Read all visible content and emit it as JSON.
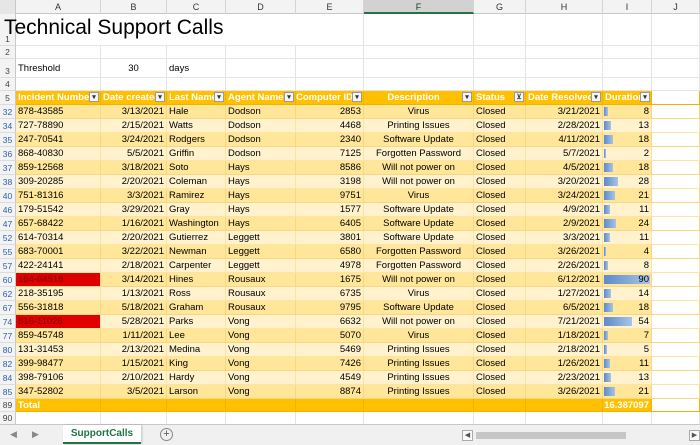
{
  "columns": [
    "A",
    "B",
    "C",
    "D",
    "E",
    "F",
    "G",
    "H",
    "I",
    "J"
  ],
  "title": "Technical Support Calls",
  "threshold": {
    "label": "Threshold",
    "value": "30",
    "unit": "days"
  },
  "headers": [
    "Incident Number",
    "Date created",
    "Last Name",
    "Agent Name",
    "Computer ID",
    "Description",
    "Status",
    "Date Resolved",
    "Duration"
  ],
  "rows": [
    {
      "rn": "32",
      "inc": "878-43585",
      "date": "3/13/2021",
      "last": "Hale",
      "agent": "Dodson",
      "cid": "2853",
      "desc": "Virus",
      "status": "Closed",
      "res": "3/21/2021",
      "dur": "8",
      "red": false
    },
    {
      "rn": "34",
      "inc": "727-78890",
      "date": "2/15/2021",
      "last": "Watts",
      "agent": "Dodson",
      "cid": "4468",
      "desc": "Printing Issues",
      "status": "Closed",
      "res": "2/28/2021",
      "dur": "13",
      "red": false
    },
    {
      "rn": "35",
      "inc": "247-70541",
      "date": "3/24/2021",
      "last": "Rodgers",
      "agent": "Dodson",
      "cid": "2340",
      "desc": "Software Update",
      "status": "Closed",
      "res": "4/11/2021",
      "dur": "18",
      "red": false
    },
    {
      "rn": "36",
      "inc": "868-40830",
      "date": "5/5/2021",
      "last": "Griffin",
      "agent": "Dodson",
      "cid": "7125",
      "desc": "Forgotten Password",
      "status": "Closed",
      "res": "5/7/2021",
      "dur": "2",
      "red": false
    },
    {
      "rn": "37",
      "inc": "859-12568",
      "date": "3/18/2021",
      "last": "Soto",
      "agent": "Hays",
      "cid": "8586",
      "desc": "Will not power on",
      "status": "Closed",
      "res": "4/5/2021",
      "dur": "18",
      "red": false
    },
    {
      "rn": "38",
      "inc": "309-20285",
      "date": "2/20/2021",
      "last": "Coleman",
      "agent": "Hays",
      "cid": "3198",
      "desc": "Will not power on",
      "status": "Closed",
      "res": "3/20/2021",
      "dur": "28",
      "red": false
    },
    {
      "rn": "40",
      "inc": "751-81316",
      "date": "3/3/2021",
      "last": "Ramirez",
      "agent": "Hays",
      "cid": "9751",
      "desc": "Virus",
      "status": "Closed",
      "res": "3/24/2021",
      "dur": "21",
      "red": false
    },
    {
      "rn": "46",
      "inc": "179-51542",
      "date": "3/29/2021",
      "last": "Gray",
      "agent": "Hays",
      "cid": "1577",
      "desc": "Software Update",
      "status": "Closed",
      "res": "4/9/2021",
      "dur": "11",
      "red": false
    },
    {
      "rn": "47",
      "inc": "657-68422",
      "date": "1/16/2021",
      "last": "Washington",
      "agent": "Hays",
      "cid": "6405",
      "desc": "Software Update",
      "status": "Closed",
      "res": "2/9/2021",
      "dur": "24",
      "red": false
    },
    {
      "rn": "52",
      "inc": "614-70314",
      "date": "2/20/2021",
      "last": "Gutierrez",
      "agent": "Leggett",
      "cid": "3801",
      "desc": "Software Update",
      "status": "Closed",
      "res": "3/3/2021",
      "dur": "11",
      "red": false
    },
    {
      "rn": "55",
      "inc": "683-70001",
      "date": "3/22/2021",
      "last": "Newman",
      "agent": "Leggett",
      "cid": "6580",
      "desc": "Forgotten Password",
      "status": "Closed",
      "res": "3/26/2021",
      "dur": "4",
      "red": false
    },
    {
      "rn": "57",
      "inc": "422-24141",
      "date": "2/18/2021",
      "last": "Carpenter",
      "agent": "Leggett",
      "cid": "4978",
      "desc": "Forgotten Password",
      "status": "Closed",
      "res": "2/26/2021",
      "dur": "8",
      "red": false
    },
    {
      "rn": "60",
      "inc": "164-64518",
      "date": "3/14/2021",
      "last": "Hines",
      "agent": "Rousaux",
      "cid": "1675",
      "desc": "Will not power on",
      "status": "Closed",
      "res": "6/12/2021",
      "dur": "90",
      "red": true
    },
    {
      "rn": "62",
      "inc": "218-35195",
      "date": "1/13/2021",
      "last": "Ross",
      "agent": "Rousaux",
      "cid": "6735",
      "desc": "Virus",
      "status": "Closed",
      "res": "1/27/2021",
      "dur": "14",
      "red": false
    },
    {
      "rn": "67",
      "inc": "556-31818",
      "date": "5/18/2021",
      "last": "Graham",
      "agent": "Rousaux",
      "cid": "9795",
      "desc": "Software Update",
      "status": "Closed",
      "res": "6/5/2021",
      "dur": "18",
      "red": false
    },
    {
      "rn": "74",
      "inc": "816-11026",
      "date": "5/28/2021",
      "last": "Parks",
      "agent": "Vong",
      "cid": "6632",
      "desc": "Will not power on",
      "status": "Closed",
      "res": "7/21/2021",
      "dur": "54",
      "red": true
    },
    {
      "rn": "77",
      "inc": "859-45748",
      "date": "1/11/2021",
      "last": "Lee",
      "agent": "Vong",
      "cid": "5070",
      "desc": "Virus",
      "status": "Closed",
      "res": "1/18/2021",
      "dur": "7",
      "red": false
    },
    {
      "rn": "80",
      "inc": "131-31453",
      "date": "2/13/2021",
      "last": "Medina",
      "agent": "Vong",
      "cid": "5469",
      "desc": "Printing Issues",
      "status": "Closed",
      "res": "2/18/2021",
      "dur": "5",
      "red": false
    },
    {
      "rn": "82",
      "inc": "399-98477",
      "date": "1/15/2021",
      "last": "King",
      "agent": "Vong",
      "cid": "7426",
      "desc": "Printing Issues",
      "status": "Closed",
      "res": "1/26/2021",
      "dur": "11",
      "red": false
    },
    {
      "rn": "84",
      "inc": "398-79106",
      "date": "2/10/2021",
      "last": "Hardy",
      "agent": "Vong",
      "cid": "4549",
      "desc": "Printing Issues",
      "status": "Closed",
      "res": "2/23/2021",
      "dur": "13",
      "red": false
    },
    {
      "rn": "85",
      "inc": "347-52802",
      "date": "3/5/2021",
      "last": "Larson",
      "agent": "Vong",
      "cid": "8874",
      "desc": "Printing Issues",
      "status": "Closed",
      "res": "3/26/2021",
      "dur": "21",
      "red": false
    }
  ],
  "total": {
    "rn": "89",
    "label": "Total",
    "value": "16.387097"
  },
  "last_row": "90",
  "duration_max": 90,
  "sheet_tab": "SupportCalls",
  "colors": {
    "header": "#ffc000",
    "band_light": "#fff2cc",
    "band_dark": "#ffe699",
    "highlight": "#e00000",
    "databar": "#5b8bc9"
  }
}
